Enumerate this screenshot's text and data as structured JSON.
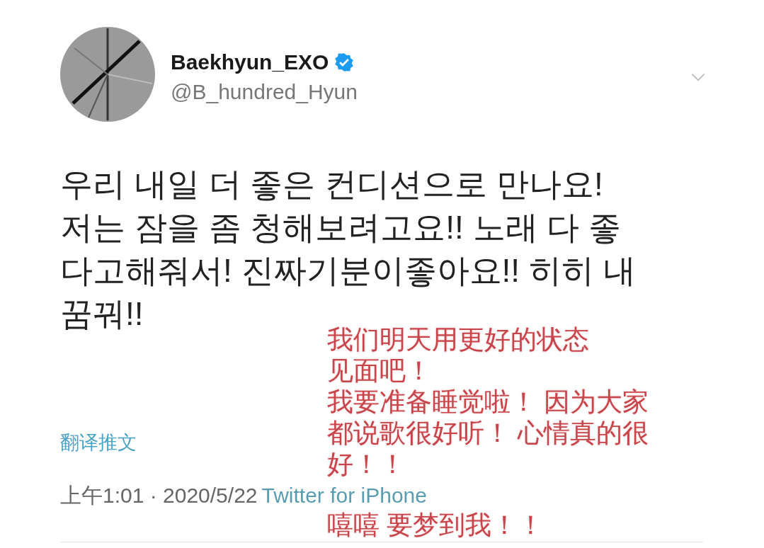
{
  "tweet": {
    "author": {
      "name": "Baekhyun_EXO",
      "verified": true,
      "handle": "@B_hundred_Hyun"
    },
    "text": "우리 내일 더 좋은 컨디션으로 만나요!\n저는 잠을 좀 청해보려고요!! 노래 다 좋다고해줘서! 진짜기분이좋아요!! 히히 내꿈꿔!!",
    "translate_link": "翻译推文",
    "timestamp": "上午1:01 · 2020/5/22",
    "source": "Twitter for iPhone"
  },
  "translation_overlay": {
    "lines": [
      "我们明天用更好的状态",
      "见面吧！",
      "我要准备睡觉啦！ 因为大家",
      "都说歌很好听！ 心情真的很",
      "好！！",
      "嘻嘻 要梦到我！！"
    ]
  }
}
